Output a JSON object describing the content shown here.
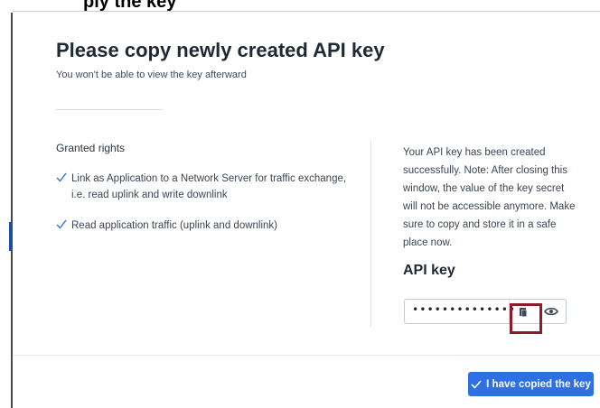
{
  "backdrop": {
    "heading_fragment": "ply the key"
  },
  "dialog": {
    "title": "Please copy newly created API key",
    "subtitle": "You won't be able to view the key afterward",
    "rights_heading": "Granted rights",
    "rights": [
      "Link as Application to a Network Server for traffic exchange, i.e. read uplink and write downlink",
      "Read application traffic (uplink and downlink)"
    ],
    "note": "Your API key has been created successfully. Note: After closing this window, the value of the key secret will not be accessible anymore. Make sure to copy and store it in a safe place now.",
    "key_label": "API key",
    "key_value": "••••••••••••••••",
    "confirm_label": "I have copied the key"
  },
  "icons": {
    "rights_item": "check-icon",
    "copy": "copy-icon",
    "reveal": "eye-icon",
    "confirm": "check-icon"
  },
  "colors": {
    "accent": "#2f6fe4",
    "highlight": "#8c1c2b",
    "title": "#1f2933",
    "body_text": "#3b4552"
  }
}
